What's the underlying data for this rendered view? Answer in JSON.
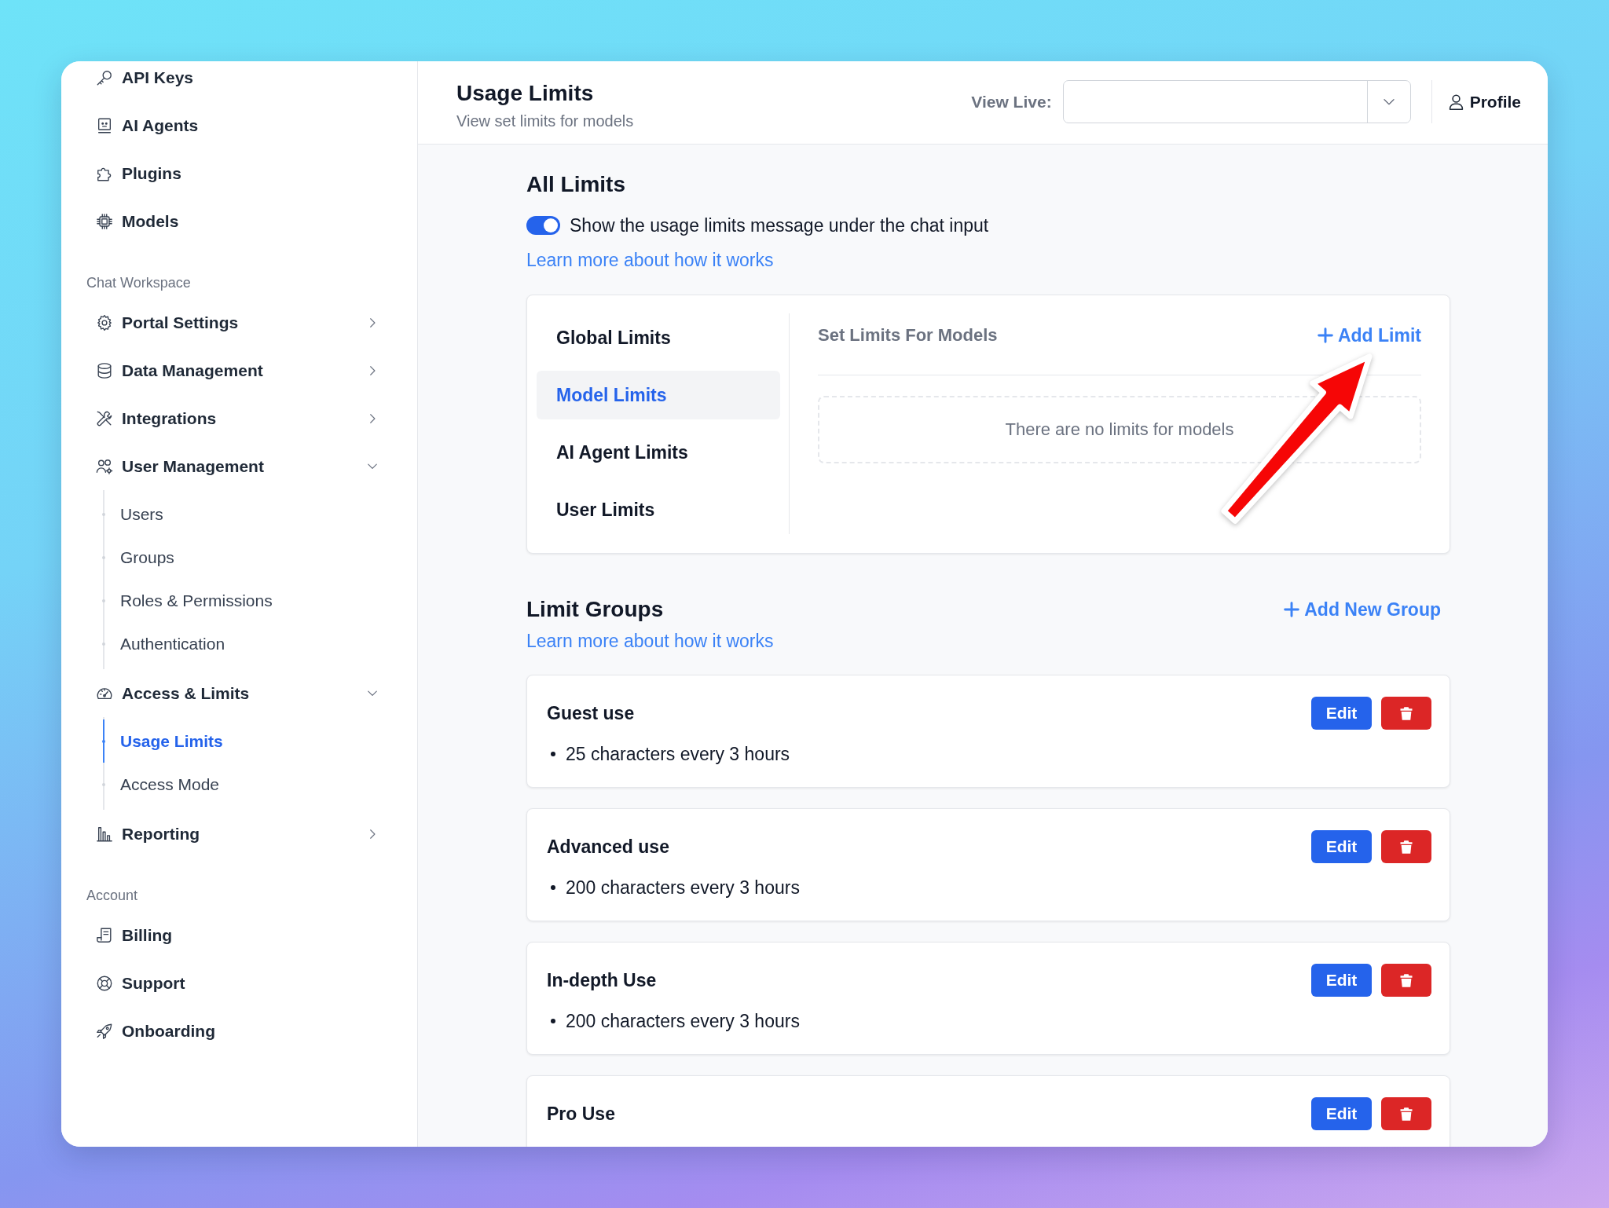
{
  "sidebar": {
    "sections": [
      {
        "items": [
          {
            "label": "API Keys",
            "kind": "link",
            "selected": false
          },
          {
            "label": "AI Agents",
            "kind": "link",
            "selected": false
          },
          {
            "label": "Plugins",
            "kind": "link",
            "selected": false
          },
          {
            "label": "Models",
            "kind": "link",
            "selected": false
          }
        ]
      },
      {
        "title": "Chat Workspace",
        "items": [
          {
            "label": "Portal Settings",
            "kind": "group",
            "expanded": false,
            "selected": false
          },
          {
            "label": "Data Management",
            "kind": "group",
            "expanded": false,
            "selected": false
          },
          {
            "label": "Integrations",
            "kind": "group",
            "expanded": false,
            "selected": false
          },
          {
            "label": "User Management",
            "kind": "group",
            "expanded": true,
            "selected": false,
            "children": [
              {
                "label": "Users",
                "selected": false
              },
              {
                "label": "Groups",
                "selected": false
              },
              {
                "label": "Roles & Permissions",
                "selected": false
              },
              {
                "label": "Authentication",
                "selected": false
              }
            ]
          },
          {
            "label": "Access & Limits",
            "kind": "group",
            "expanded": true,
            "selected": false,
            "children": [
              {
                "label": "Usage Limits",
                "selected": true
              },
              {
                "label": "Access Mode",
                "selected": false
              }
            ]
          },
          {
            "label": "Reporting",
            "kind": "group",
            "expanded": false,
            "selected": false
          }
        ]
      },
      {
        "title": "Account",
        "items": [
          {
            "label": "Billing",
            "kind": "link",
            "selected": false
          },
          {
            "label": "Support",
            "kind": "link",
            "selected": false
          },
          {
            "label": "Onboarding",
            "kind": "link",
            "selected": false
          }
        ]
      }
    ]
  },
  "header": {
    "title": "Usage Limits",
    "subtitle": "View set limits for models",
    "view_live": {
      "label": "View Live:"
    },
    "profile_button": "Profile"
  },
  "all_limits": {
    "title": "All Limits",
    "toggle": {
      "label": "Show the usage limits message under the chat input",
      "on": true
    },
    "link": "Learn more about how it works",
    "panel": {
      "tabs": [
        {
          "label": "Global Limits",
          "selected": false
        },
        {
          "label": "Model Limits",
          "selected": true
        },
        {
          "label": "AI Agent Limits",
          "selected": false
        },
        {
          "label": "User Limits",
          "selected": false
        }
      ],
      "heading": "Set Limits For Models",
      "add_button": "Add Limit",
      "empty_message": "There are no limits for models"
    }
  },
  "limit_groups": {
    "title": "Limit Groups",
    "add_button": "Add New Group",
    "link": "Learn more about how it works",
    "groups": [
      {
        "name": "Guest use",
        "rules": [
          "25 characters every 3 hours"
        ],
        "edit_button": "Edit"
      },
      {
        "name": "Advanced use",
        "rules": [
          "200 characters every 3 hours"
        ],
        "edit_button": "Edit"
      },
      {
        "name": "In-depth Use",
        "rules": [
          "200 characters every 3 hours"
        ],
        "edit_button": "Edit"
      },
      {
        "name": "Pro Use",
        "edit_button": "Edit"
      }
    ]
  }
}
